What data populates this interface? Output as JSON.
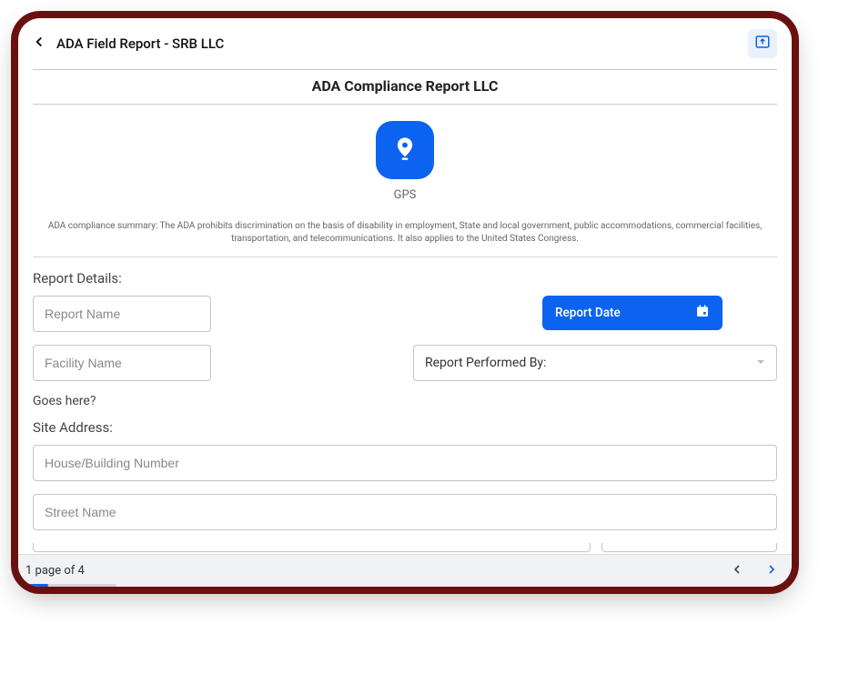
{
  "header": {
    "title": "ADA Field Report - SRB LLC"
  },
  "report": {
    "company_title": "ADA Compliance Report LLC",
    "gps_label": "GPS",
    "summary": "ADA compliance summary:  The ADA prohibits discrimination on the basis of disability in employment,  State and local government, public    accommodations, commercial facilities,  transportation, and telecommunications.  It also applies to the United States Congress."
  },
  "form": {
    "details_label": "Report Details:",
    "report_name_placeholder": "Report Name",
    "report_date_label": "Report Date",
    "facility_name_placeholder": "Facility Name",
    "performed_by_label": "Report Performed By:",
    "goes_here_label": "Goes here?",
    "site_address_label": "Site Address:",
    "house_number_placeholder": "House/Building Number",
    "street_name_placeholder": "Street Name"
  },
  "footer": {
    "page_text": "1 page of 4"
  }
}
